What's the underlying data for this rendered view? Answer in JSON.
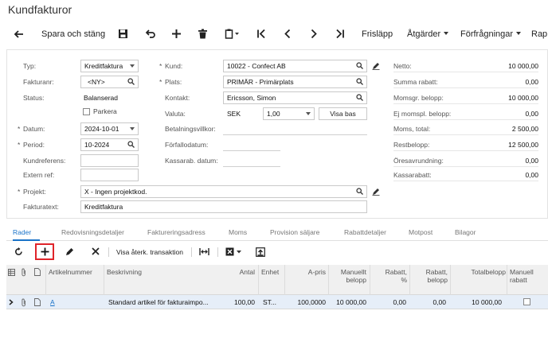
{
  "app": {
    "title": "Kundfakturor"
  },
  "toolbar": {
    "save_close_label": "Spara och stäng",
    "release_label": "Frisläpp",
    "actions_label": "Åtgärder",
    "inquiries_label": "Förfrågningar",
    "reports_label": "Rap"
  },
  "form": {
    "type": {
      "label": "Typ:",
      "value": "Kreditfaktura"
    },
    "invoice_no": {
      "label": "Fakturanr:",
      "value": "<NY>"
    },
    "status": {
      "label": "Status:",
      "value": "Balanserad"
    },
    "parked": {
      "label": "Parkera",
      "checked": false
    },
    "date": {
      "label": "Datum:",
      "value": "2024-10-01"
    },
    "period": {
      "label": "Period:",
      "value": "10-2024"
    },
    "customer_ref": {
      "label": "Kundreferens:",
      "value": ""
    },
    "external_ref": {
      "label": "Extern ref:",
      "value": ""
    },
    "customer": {
      "label": "Kund:",
      "value": "10022 - Confect AB"
    },
    "location": {
      "label": "Plats:",
      "value": "PRIMÄR - Primärplats"
    },
    "contact": {
      "label": "Kontakt:",
      "value": "Ericsson, Simon"
    },
    "currency": {
      "label": "Valuta:",
      "code": "SEK",
      "rate": "1,00",
      "view_base_label": "Visa bas"
    },
    "payment_terms": {
      "label": "Betalningsvillkor:",
      "value": ""
    },
    "due_date": {
      "label": "Förfallodatum:",
      "value": ""
    },
    "cash_discount_date": {
      "label": "Kassarab. datum:",
      "value": ""
    },
    "project": {
      "label": "Projekt:",
      "value": "X - Ingen projektkod."
    },
    "invoice_text": {
      "label": "Fakturatext:",
      "value": "Kreditfaktura"
    }
  },
  "summary": {
    "net": {
      "label": "Netto:",
      "value": "10 000,00"
    },
    "total_discount": {
      "label": "Summa rabatt:",
      "value": "0,00"
    },
    "vat_taxable": {
      "label": "Momsgr. belopp:",
      "value": "10 000,00"
    },
    "vat_exempt": {
      "label": "Ej momspl. belopp:",
      "value": "0,00"
    },
    "vat_total": {
      "label": "Moms, total:",
      "value": "2 500,00"
    },
    "balance": {
      "label": "Restbelopp:",
      "value": "12 500,00"
    },
    "rounding": {
      "label": "Öresavrundning:",
      "value": "0,00"
    },
    "cash_discount": {
      "label": "Kassarabatt:",
      "value": "0,00"
    }
  },
  "tabs": [
    "Rader",
    "Redovisningsdetaljer",
    "Faktureringsadress",
    "Moms",
    "Provision säljare",
    "Rabattdetaljer",
    "Motpost",
    "Bilagor"
  ],
  "grid_toolbar": {
    "view_reversal_label": "Visa återk. transaktion"
  },
  "grid": {
    "columns": {
      "article_no": "Artikelnummer",
      "description": "Beskrivning",
      "quantity": "Antal",
      "unit": "Enhet",
      "unit_price": "A-pris",
      "manual_amount": "Manuellt belopp",
      "discount_pct": "Rabatt, %",
      "discount_amount": "Rabatt, belopp",
      "total_amount": "Totalbelopp",
      "manual_discount": "Manuell rabatt"
    },
    "rows": [
      {
        "article_no": "A",
        "description": "Standard artikel för fakturaimpo...",
        "quantity": "100,00",
        "unit": "ST...",
        "unit_price": "100,0000",
        "manual_amount": "10 000,00",
        "discount_pct": "0,00",
        "discount_amount": "0,00",
        "total_amount": "10 000,00",
        "manual_discount": false
      }
    ]
  }
}
